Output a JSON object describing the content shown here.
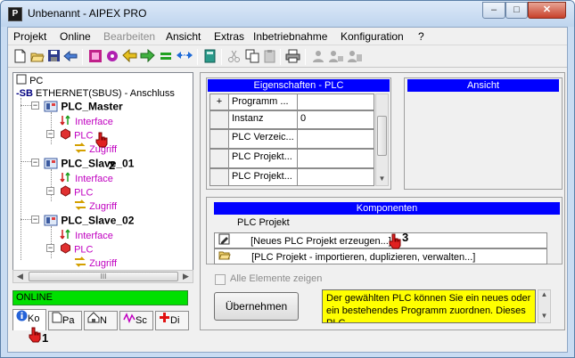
{
  "window": {
    "title": "Unbenannt - AIPEX PRO",
    "min": "–",
    "max": "□",
    "close": "✕"
  },
  "menu": [
    "Projekt",
    "Online",
    "Bearbeiten",
    "Ansicht",
    "Extras",
    "Inbetriebnahme",
    "Konfiguration",
    "?"
  ],
  "toolbar_icons": [
    "new-icon",
    "open-icon",
    "save-icon",
    "back-icon",
    "print-preview-icon",
    "settings-icon",
    "arrow-left-icon",
    "arrow-right-icon",
    "equal-icon",
    "swap-icon",
    "calculator-icon",
    "cut-icon",
    "copy-icon",
    "paste-icon",
    "printer-icon",
    "user-icon",
    "users-icon",
    "group-icon"
  ],
  "tree": {
    "root": "PC",
    "bus_prefix": "-SB",
    "bus": "ETHERNET(SBUS) - Anschluss",
    "master": "PLC_Master",
    "slave1": "PLC_Slave_01",
    "slave2": "PLC_Slave_02",
    "interface": "Interface",
    "plc": "PLC",
    "zugriff": "Zugriff",
    "scroll_grip": "III"
  },
  "status": {
    "online": "ONLINE"
  },
  "tabs": [
    "Ko",
    "Pa",
    "N",
    "Sc",
    "Di"
  ],
  "properties": {
    "header": "Eigenschaften - PLC",
    "rows": [
      {
        "expander": "+",
        "name": "Programm ...",
        "value": ""
      },
      {
        "expander": "",
        "name": "Instanz",
        "value": "0"
      },
      {
        "expander": "",
        "name": "PLC Verzeic...",
        "value": ""
      },
      {
        "expander": "",
        "name": "PLC Projekt...",
        "value": ""
      },
      {
        "expander": "",
        "name": "PLC Projekt...",
        "value": ""
      }
    ]
  },
  "ansicht": {
    "header": "Ansicht"
  },
  "komponenten": {
    "header": "Komponenten",
    "column": "PLC Projekt",
    "items": [
      "[Neues PLC Projekt erzeugen...]",
      "[PLC Projekt - importieren, duplizieren, verwalten...]"
    ]
  },
  "controls": {
    "all_elements": "Alle Elemente zeigen",
    "apply_button": "Übernehmen",
    "info_text": "Der gewählten PLC können Sie ein neues oder ein bestehendes Programm zuordnen. Dieses PLC"
  },
  "markers": [
    "1",
    "2",
    "3"
  ],
  "colors": {
    "header_blue": "#0000ff",
    "online_green": "#00e000",
    "info_yellow": "#ffff00",
    "tree_magenta": "#c000c0"
  }
}
